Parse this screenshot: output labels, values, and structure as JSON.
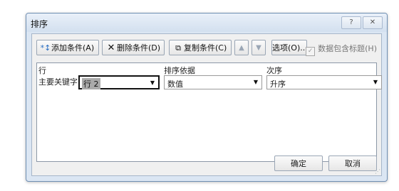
{
  "window": {
    "title": "排序",
    "help_label": "?",
    "close_label": "✕"
  },
  "toolbar": {
    "add_label": "添加条件(A)",
    "delete_label": "删除条件(D)",
    "copy_label": "复制条件(C)",
    "up_label": "▲",
    "down_label": "▼",
    "options_label": "选项(O)...",
    "has_headers_label": "数据包含标题(H)",
    "has_headers_checked": true
  },
  "grid": {
    "headers": {
      "column": "行",
      "sort_on": "排序依据",
      "order": "次序"
    },
    "rows": [
      {
        "label": "主要关键字",
        "column_value": "行 2",
        "sort_on_value": "数值",
        "order_value": "升序"
      }
    ]
  },
  "footer": {
    "ok_label": "确定",
    "cancel_label": "取消"
  }
}
